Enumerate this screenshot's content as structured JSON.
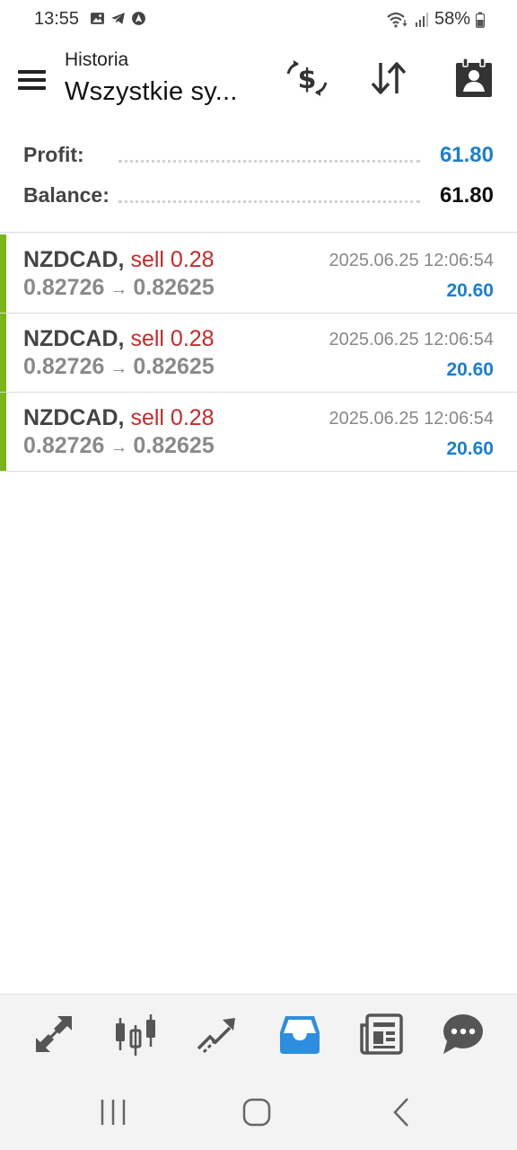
{
  "status_bar": {
    "time": "13:55",
    "battery": "58%",
    "icons": [
      "gallery-icon",
      "telegram-icon",
      "location-icon",
      "wifi-icon",
      "signal-icon",
      "battery-icon"
    ]
  },
  "header": {
    "subtitle": "Historia",
    "title": "Wszystkie sy...",
    "tools": [
      "currency-exchange-icon",
      "sort-icon",
      "account-icon"
    ]
  },
  "summary": {
    "profit_label": "Profit:",
    "profit_value": "61.80",
    "balance_label": "Balance:",
    "balance_value": "61.80"
  },
  "trades": [
    {
      "symbol": "NZDCAD,",
      "side": "sell 0.28",
      "open_price": "0.82726",
      "arrow": "→",
      "close_price": "0.82625",
      "time": "2025.06.25 12:06:54",
      "profit": "20.60"
    },
    {
      "symbol": "NZDCAD,",
      "side": "sell 0.28",
      "open_price": "0.82726",
      "arrow": "→",
      "close_price": "0.82625",
      "time": "2025.06.25 12:06:54",
      "profit": "20.60"
    },
    {
      "symbol": "NZDCAD,",
      "side": "sell 0.28",
      "open_price": "0.82726",
      "arrow": "→",
      "close_price": "0.82625",
      "time": "2025.06.25 12:06:54",
      "profit": "20.60"
    }
  ],
  "colors": {
    "accent_blue": "#1a7fd1",
    "sell_red": "#c62a2a",
    "bar_green": "#7cb518",
    "active_tab": "#2d8ee0"
  },
  "bottom_nav": [
    "quotes-icon",
    "chart-icon",
    "trade-icon",
    "history-icon",
    "news-icon",
    "chat-icon"
  ],
  "active_tab": "history-icon"
}
